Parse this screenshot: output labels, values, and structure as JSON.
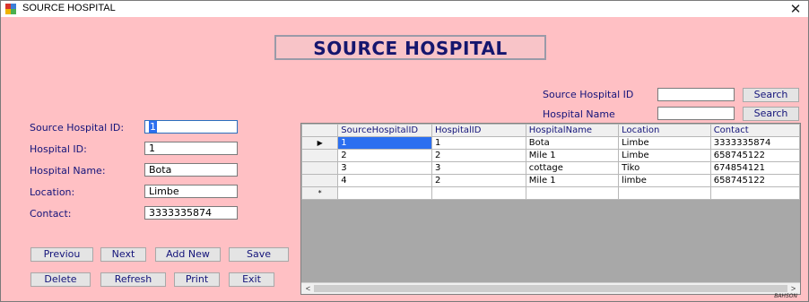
{
  "window": {
    "title": "SOURCE HOSPITAL",
    "close_icon": "close-icon"
  },
  "banner": {
    "title": "SOURCE HOSPITAL"
  },
  "search": {
    "source_label": "Source Hospital ID",
    "source_value": "",
    "source_button": "Search",
    "hospital_label": "Hospital Name",
    "hospital_value": "",
    "hospital_button": "Search"
  },
  "form": {
    "source_id_label": "Source Hospital ID:",
    "source_id_value": "1",
    "hospital_id_label": "Hospital ID:",
    "hospital_id_value": "1",
    "hospital_name_label": "Hospital Name:",
    "hospital_name_value": "Bota",
    "location_label": "Location:",
    "location_value": "Limbe",
    "contact_label": "Contact:",
    "contact_value": "3333335874"
  },
  "buttons": {
    "previous": "Previou",
    "next": "Next",
    "add_new": "Add New",
    "save": "Save",
    "delete": "Delete",
    "refresh": "Refresh",
    "print": "Print",
    "exit": "Exit"
  },
  "grid": {
    "columns": [
      "SourceHospitalID",
      "HospitalID",
      "HospitalName",
      "Location",
      "Contact"
    ],
    "rows": [
      {
        "indicator": "▶",
        "cells": [
          "1",
          "1",
          "Bota",
          "Limbe",
          "3333335874"
        ]
      },
      {
        "indicator": "",
        "cells": [
          "2",
          "2",
          "Mile 1",
          "Limbe",
          "658745122"
        ]
      },
      {
        "indicator": "",
        "cells": [
          "3",
          "3",
          "cottage",
          "Tiko",
          "674854121"
        ]
      },
      {
        "indicator": "",
        "cells": [
          "4",
          "2",
          "Mile 1",
          "limbe",
          "658745122"
        ]
      }
    ],
    "new_row_indicator": "*",
    "scroll_left": "<",
    "scroll_right": ">"
  },
  "watermark": "BAHSON"
}
